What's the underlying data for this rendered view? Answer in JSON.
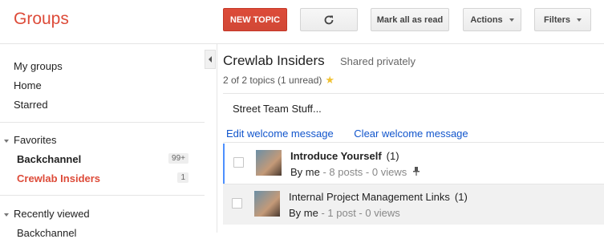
{
  "header": {
    "logo": "Groups",
    "new_topic": "NEW TOPIC",
    "refresh_icon": "refresh-icon",
    "mark_all_read": "Mark all as read",
    "actions": "Actions",
    "filters": "Filters"
  },
  "sidebar": {
    "links": [
      "My groups",
      "Home",
      "Starred"
    ],
    "favorites_title": "Favorites",
    "favorites": [
      {
        "name": "Backchannel",
        "badge": "99+",
        "color": "#222222"
      },
      {
        "name": "Crewlab Insiders",
        "badge": "1",
        "color": "#dd4b39"
      }
    ],
    "recent_title": "Recently viewed",
    "recent_first": "Backchannel"
  },
  "main": {
    "group_name": "Crewlab Insiders",
    "privacy": "Shared privately",
    "topic_count": "2 of 2 topics (1 unread)",
    "welcome_text": "Street Team Stuff...",
    "edit_welcome": "Edit welcome message",
    "clear_welcome": "Clear welcome message",
    "topics": [
      {
        "title": "Introduce Yourself",
        "count": "(1)",
        "by": "By me",
        "meta": " - 8 posts - 0 views",
        "unread": true
      },
      {
        "title": "Internal Project Management Links",
        "count": "(1)",
        "by": "By me",
        "meta": " - 1 post - 0 views",
        "unread": false
      }
    ]
  },
  "colors": {
    "brand": "#dd4b39",
    "link": "#1155cc",
    "selected": "#4d90fe"
  }
}
